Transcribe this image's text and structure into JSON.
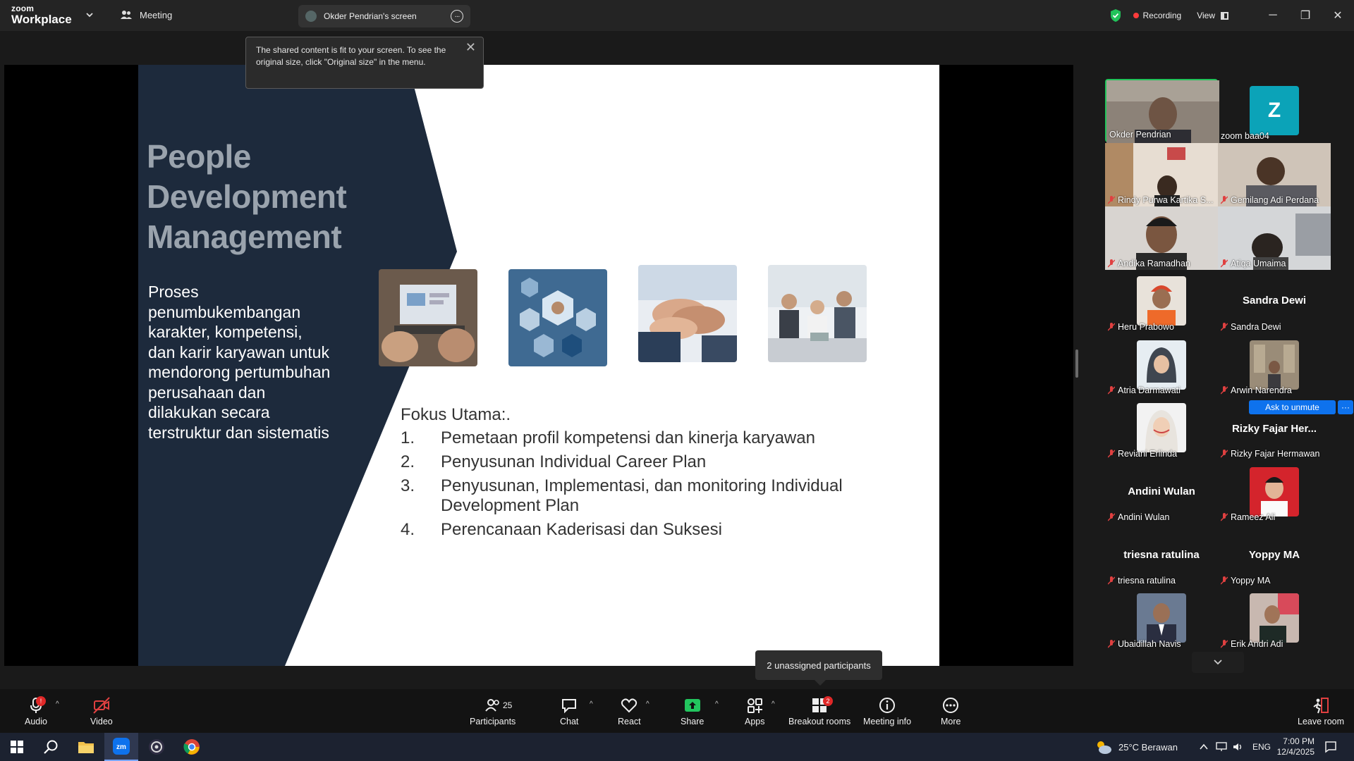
{
  "app": {
    "logo_line1": "zoom",
    "logo_line2": "Workplace",
    "meeting_label": "Meeting",
    "shared_tab": "Okder Pendrian's screen",
    "recording": "Recording",
    "view": "View"
  },
  "tooltip": {
    "text": "The shared content is fit to your screen. To see the original size, click \"Original size\" in the menu."
  },
  "slide": {
    "title_lines": [
      "People",
      "Development",
      "Management"
    ],
    "description": "Proses penumbukembangan karakter, kompetensi, dan karir karyawan untuk mendorong pertumbuhan perusahaan dan dilakukan secara terstruktur dan sistematis",
    "focus_heading": "Fokus Utama:.",
    "focus_items": [
      {
        "num": "1.",
        "text": "Pemetaan profil kompetensi dan kinerja karyawan"
      },
      {
        "num": "2.",
        "text": "Penyusunan Individual Career Plan"
      },
      {
        "num": "3.",
        "text": "Penyusunan, Implementasi, dan monitoring Individual Development Plan"
      },
      {
        "num": "4.",
        "text": "Perencanaan Kaderisasi dan Suksesi"
      }
    ]
  },
  "participants": [
    {
      "name": "Okder Pendrian",
      "muted": false
    },
    {
      "name": "zoom baa04",
      "muted": false,
      "initial": "Z"
    },
    {
      "name": "Rindy Purwa Kartika S...",
      "muted": true
    },
    {
      "name": "Gemilang Adi Perdana",
      "muted": true
    },
    {
      "name": "Andika Ramadhan",
      "muted": true
    },
    {
      "name": "Atiqa Umaima",
      "muted": true
    },
    {
      "name": "Heru Prabowo",
      "muted": true
    },
    {
      "name": "Sandra Dewi",
      "muted": true,
      "big": "Sandra Dewi"
    },
    {
      "name": "Atria Darmawati",
      "muted": true
    },
    {
      "name": "Arwin Narendra",
      "muted": true
    },
    {
      "name": "Reviani Erlinda",
      "muted": true
    },
    {
      "name": "Rizky Fajar Hermawan",
      "muted": true,
      "big": "Rizky Fajar Her..."
    },
    {
      "name": "Andini Wulan",
      "muted": true,
      "big": "Andini Wulan"
    },
    {
      "name": "Rameez Ali",
      "muted": true
    },
    {
      "name": "triesna ratulina",
      "muted": true,
      "big": "triesna ratulina"
    },
    {
      "name": "Yoppy MA",
      "muted": true,
      "big": "Yoppy MA"
    },
    {
      "name": "Ubaidillah Navis",
      "muted": true
    },
    {
      "name": "Erik Andri Adi",
      "muted": true
    }
  ],
  "gallery": {
    "ask_unmute": "Ask to unmute",
    "more": "···"
  },
  "unassigned": "2 unassigned participants",
  "toolbar": {
    "audio": "Audio",
    "audio_badge": "!",
    "video": "Video",
    "participants": "Participants",
    "participants_count": "25",
    "chat": "Chat",
    "react": "React",
    "share": "Share",
    "apps": "Apps",
    "breakout": "Breakout rooms",
    "breakout_badge": "2",
    "meeting_info": "Meeting info",
    "more": "More",
    "leave": "Leave room"
  },
  "taskbar": {
    "weather": "25°C  Berawan",
    "lang": "ENG",
    "time": "7:00 PM",
    "date": "12/4/2025"
  },
  "colors": {
    "slide_dark": "#1d2a3c",
    "accent_green": "#21c35a",
    "zoom_blue": "#0e72ed",
    "share_green": "#22c55e",
    "avatar_teal": "#0ba3b8"
  }
}
